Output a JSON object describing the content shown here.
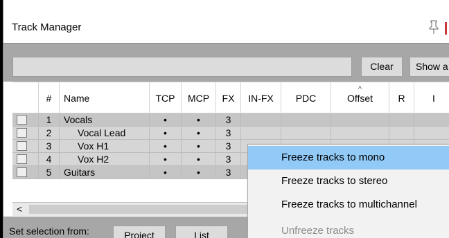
{
  "window": {
    "title": "Track Manager"
  },
  "toolbar": {
    "search_value": "",
    "clear_label": "Clear",
    "show_all_label": "Show a"
  },
  "table": {
    "headers": {
      "num": "#",
      "name": "Name",
      "tcp": "TCP",
      "mcp": "MCP",
      "fx": "FX",
      "infx": "IN-FX",
      "pdc": "PDC",
      "offset": "Offset",
      "r": "R",
      "more": "I"
    },
    "sort_indicator": "^",
    "rows": [
      {
        "num": "1",
        "name": "Vocals",
        "tcp": "•",
        "mcp": "•",
        "fx": "3"
      },
      {
        "num": "2",
        "name": "Vocal Lead",
        "tcp": "•",
        "mcp": "•",
        "fx": "3"
      },
      {
        "num": "3",
        "name": "Vox H1",
        "tcp": "•",
        "mcp": "•",
        "fx": "3"
      },
      {
        "num": "4",
        "name": "Vox H2",
        "tcp": "•",
        "mcp": "•",
        "fx": "3"
      },
      {
        "num": "5",
        "name": "Guitars",
        "tcp": "•",
        "mcp": "•",
        "fx": "3"
      }
    ]
  },
  "scrollbar": {
    "left_arrow": "<"
  },
  "footer": {
    "selection_label": "Set selection from:",
    "project_label": "Project",
    "list_label": "List"
  },
  "context_menu": {
    "items": [
      {
        "label": "Freeze tracks to mono",
        "highlighted": true
      },
      {
        "label": "Freeze tracks to stereo"
      },
      {
        "label": "Freeze tracks to multichannel"
      },
      {
        "label": "Unfreeze tracks",
        "disabled": true
      }
    ]
  },
  "colors": {
    "highlight": "#91c9f7",
    "panel": "#a7a7a7",
    "row_parent": "#c5c5c5",
    "row_child": "#d6d6d6"
  }
}
